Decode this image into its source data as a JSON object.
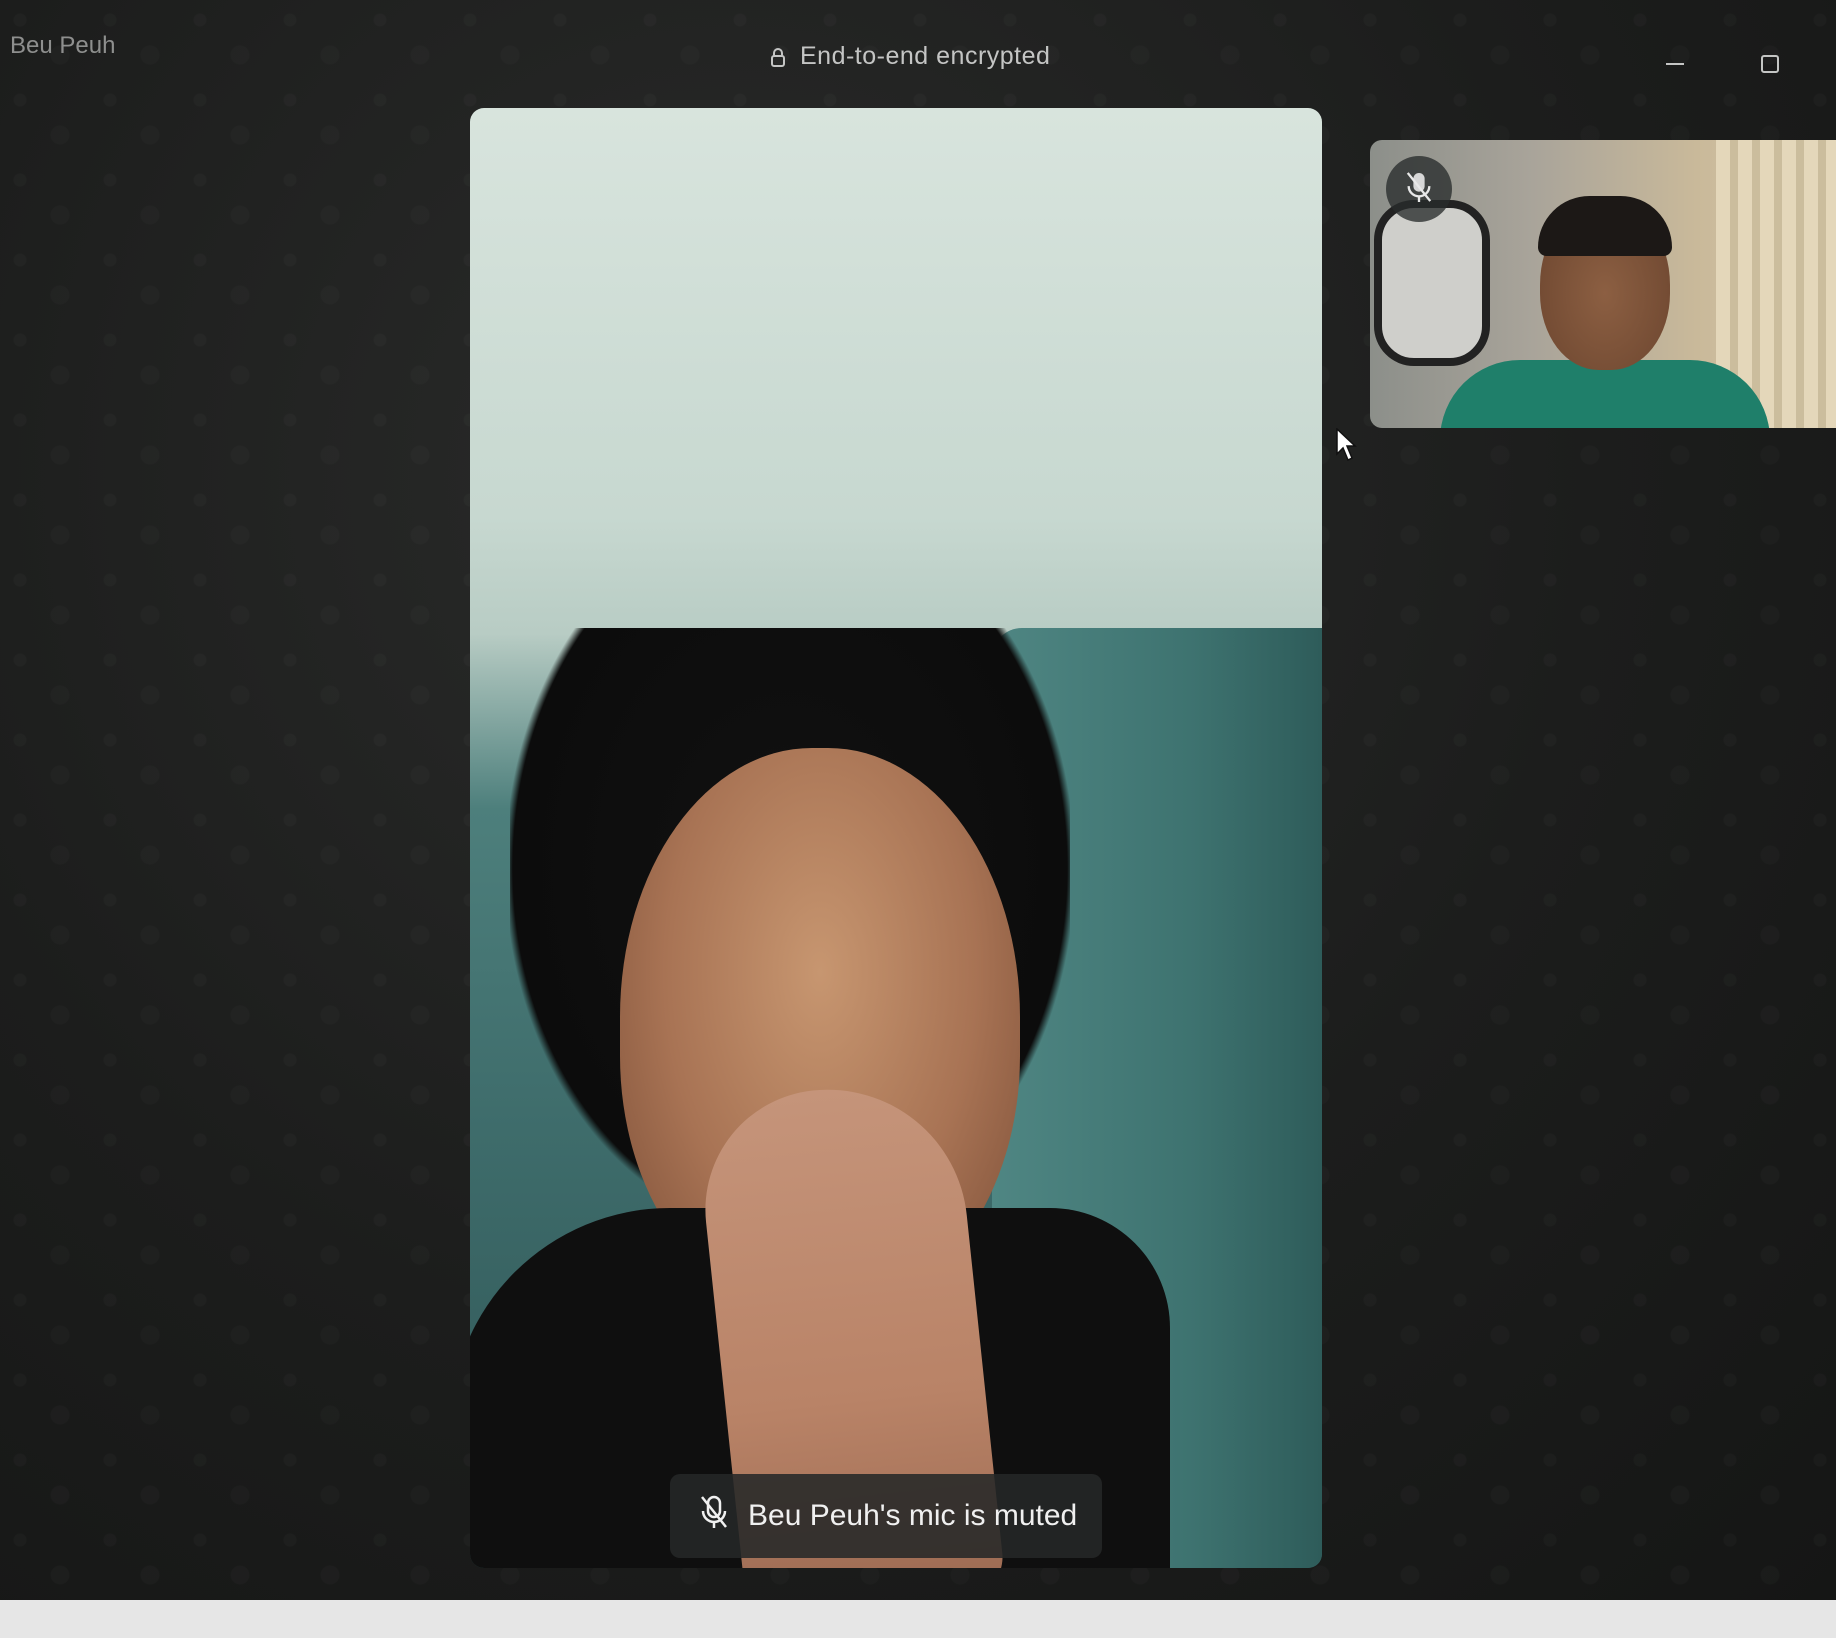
{
  "window": {
    "title": "Beu Peuh",
    "encryption_label": "End-to-end encrypted"
  },
  "icons": {
    "lock": "lock-icon",
    "minimize": "minimize-icon",
    "maximize": "maximize-icon",
    "mic_muted": "mic-muted-icon",
    "cursor": "mouse-pointer-icon"
  },
  "call": {
    "mute_notice": "Beu Peuh's mic is muted"
  },
  "colors": {
    "background": "#1c1d1c",
    "toast_bg": "#262828",
    "text_primary": "#f0f0f0",
    "text_muted": "#8e8f8e"
  }
}
